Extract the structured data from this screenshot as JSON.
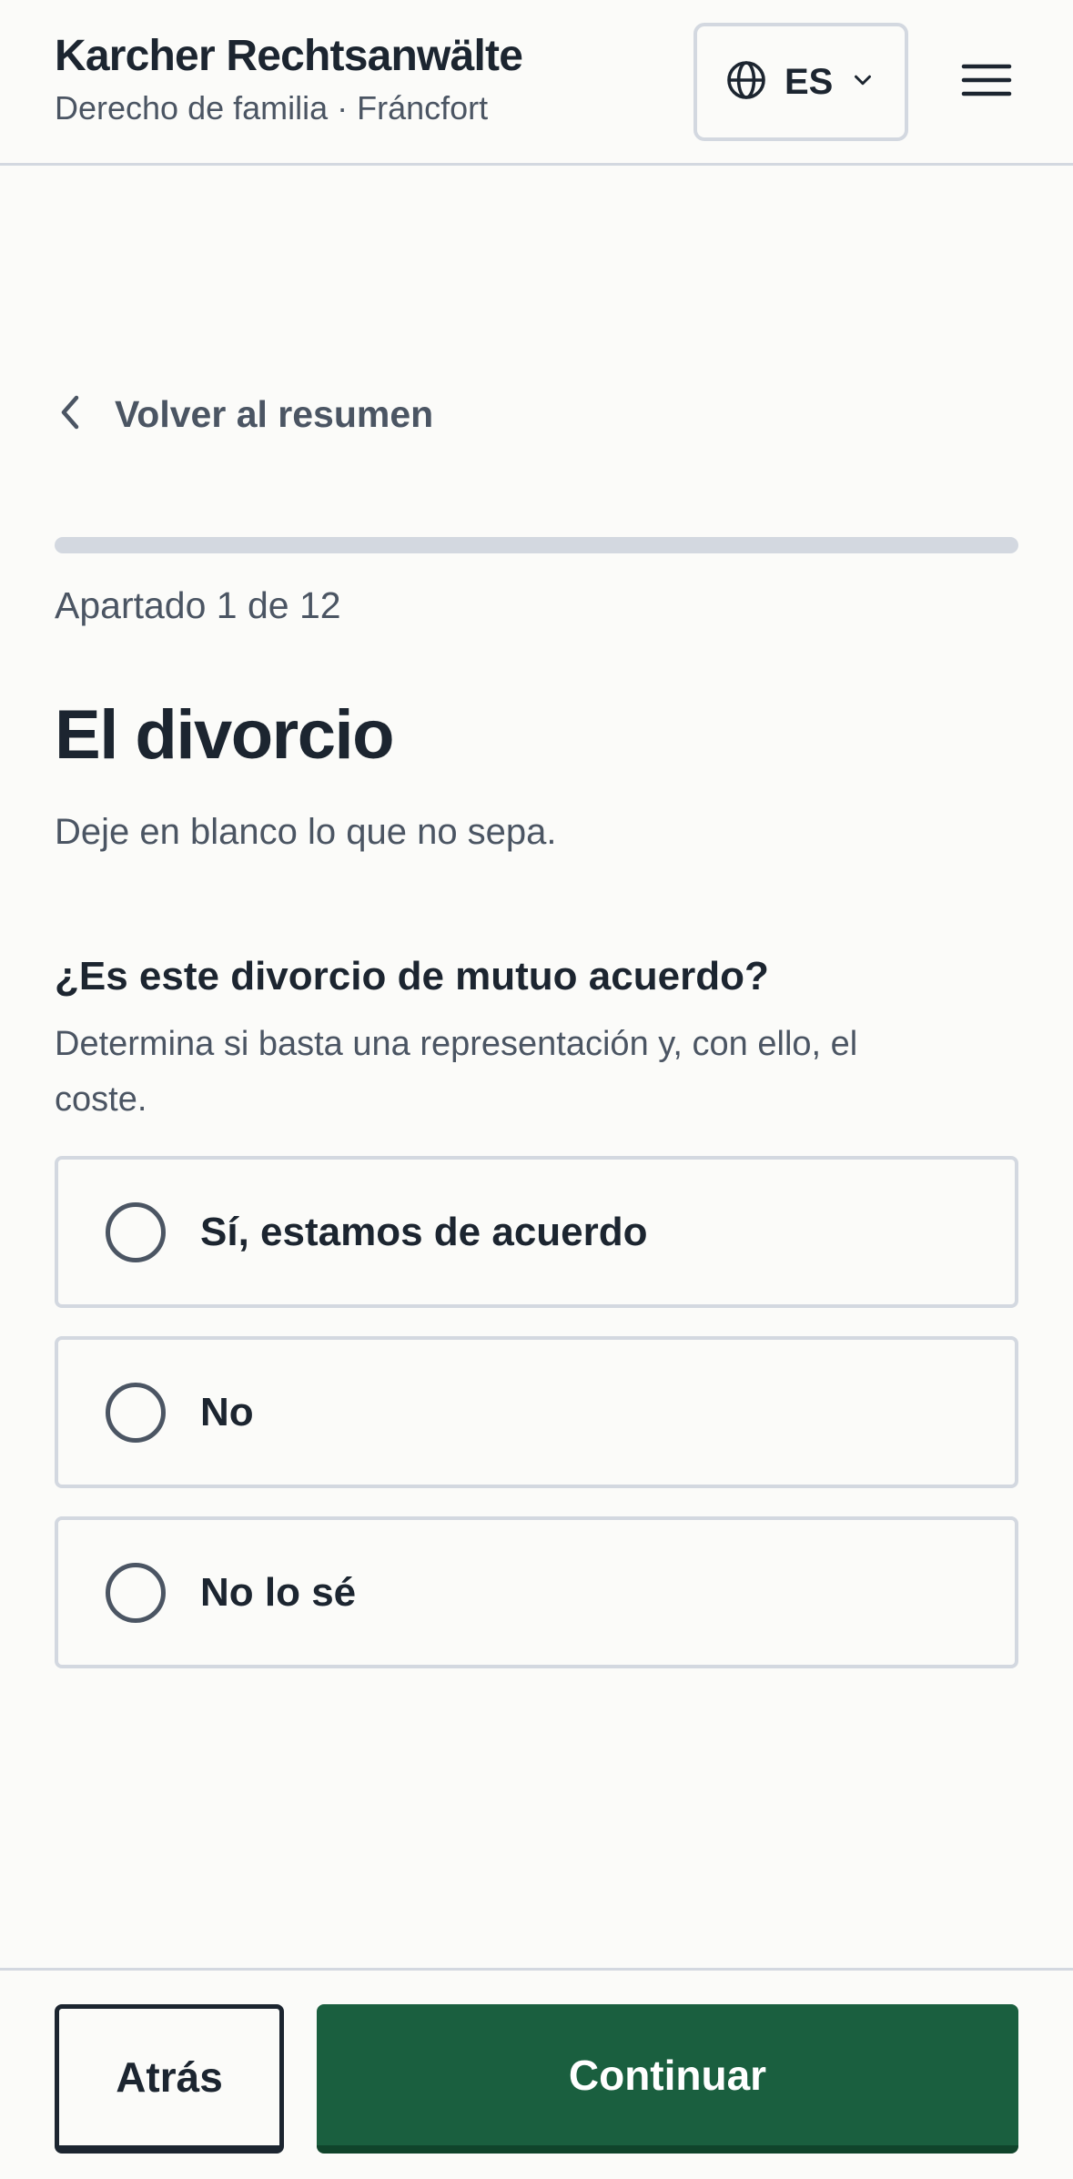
{
  "header": {
    "title": "Karcher Rechtsanwälte",
    "subtitle": "Derecho de familia · Fráncfort",
    "language": {
      "code": "ES",
      "icon": "globe-icon",
      "chevron": "chevron-down-icon"
    },
    "menu_icon": "hamburger-menu-icon"
  },
  "nav": {
    "back_label": "Volver al resumen",
    "back_icon": "chevron-left-icon"
  },
  "progress": {
    "text": "Apartado 1 de 12",
    "fraction": 0
  },
  "section": {
    "title": "El divorcio",
    "intro": "Deje en blanco lo que no sepa."
  },
  "question": {
    "label": "¿Es este divorcio de mutuo acuerdo?",
    "help": "Determina si basta una representación y, con ello, el coste.",
    "options": [
      {
        "label": "Sí, estamos de acuerdo"
      },
      {
        "label": "No"
      },
      {
        "label": "No lo sé"
      }
    ]
  },
  "footer": {
    "back_button": "Atrás",
    "continue_button": "Continuar"
  },
  "colors": {
    "accent": "#1a5f3f",
    "text": "#1c2530",
    "muted": "#4b5563",
    "border": "#d3d8e0",
    "background": "#fbfbf9"
  }
}
